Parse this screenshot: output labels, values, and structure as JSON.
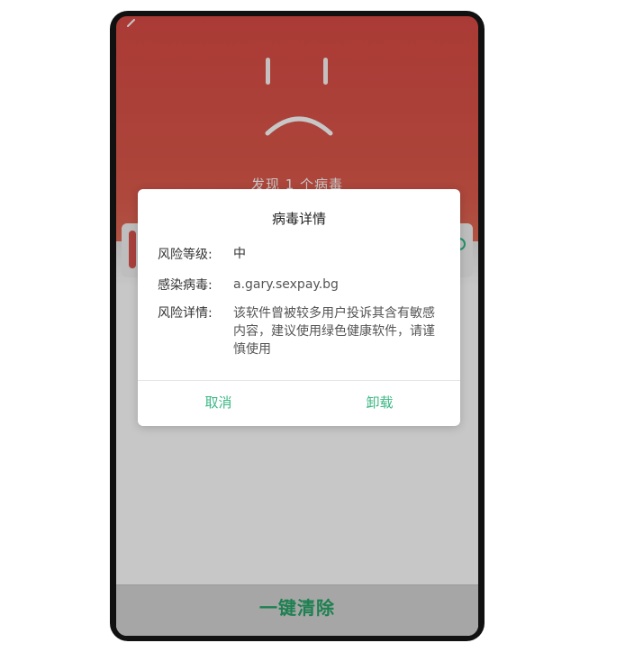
{
  "scan_screen": {
    "found_text": "发现 1 个病毒",
    "clean_button_label": "一键清除"
  },
  "dialog": {
    "title": "病毒详情",
    "rows": [
      {
        "label": "风险等级:",
        "value": "中"
      },
      {
        "label": "感染病毒:",
        "value": "a.gary.sexpay.bg"
      },
      {
        "label": "风险详情:",
        "value": "该软件曾被较多用户投诉其含有敏感内容，建议使用绿色健康软件，请谨慎使用"
      }
    ],
    "cancel_label": "取消",
    "uninstall_label": "卸载"
  },
  "colors": {
    "header_red": "#da4b45",
    "accent_green": "#3cb885"
  },
  "icons": {
    "back": "back-arrow-icon",
    "sad_face": "sad-face-icon"
  }
}
